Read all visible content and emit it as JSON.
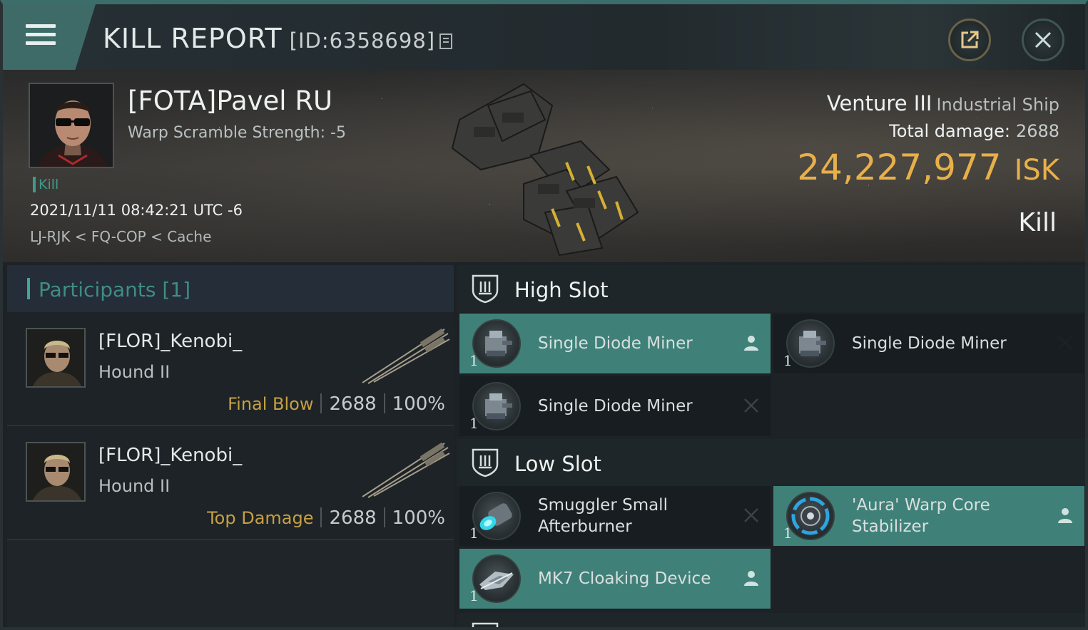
{
  "window": {
    "title": "KILL REPORT",
    "report_id": "[ID:6358698]",
    "icons": {
      "menu": "hamburger-icon",
      "copy": "copy-icon",
      "share": "share-external-icon",
      "close": "close-icon"
    }
  },
  "victim": {
    "name": "[FOTA]Pavel RU",
    "warp_scramble": "Warp Scramble Strength: -5",
    "tag": "Kill",
    "datetime": "2021/11/11 08:42:21 UTC -6",
    "location": "LJ-RJK < FQ-COP < Cache",
    "ship_name": "Venture III",
    "ship_class": "Industrial Ship",
    "total_damage_label": "Total damage:",
    "total_damage_value": "2688",
    "isk_value": "24,227,977",
    "isk_unit": "ISK",
    "outcome": "Kill"
  },
  "participants": {
    "header": "Participants [1]",
    "items": [
      {
        "name": "[FLOR]_Kenobi_",
        "ship": "Hound II",
        "role": "Final Blow",
        "damage": "2688",
        "percent": "100%"
      },
      {
        "name": "[FLOR]_Kenobi_",
        "ship": "Hound II",
        "role": "Top Damage",
        "damage": "2688",
        "percent": "100%"
      }
    ]
  },
  "slots": {
    "high": {
      "label": "High Slot",
      "modules": [
        {
          "name": "Single Diode Miner",
          "qty": "1",
          "status": "dropped",
          "icon": "miner-icon"
        },
        {
          "name": "Single Diode Miner",
          "qty": "1",
          "status": "destroyed",
          "icon": "miner-icon"
        },
        {
          "name": "Single Diode Miner",
          "qty": "1",
          "status": "destroyed",
          "icon": "miner-icon"
        }
      ]
    },
    "low": {
      "label": "Low Slot",
      "modules": [
        {
          "name": "Smuggler Small Afterburner",
          "qty": "1",
          "status": "destroyed",
          "icon": "afterburner-icon"
        },
        {
          "name": "'Aura' Warp Core Stabilizer",
          "qty": "1",
          "status": "dropped",
          "icon": "warp-core-stabilizer-icon"
        },
        {
          "name": "MK7 Cloaking Device",
          "qty": "1",
          "status": "dropped",
          "icon": "cloaking-device-icon"
        }
      ]
    }
  },
  "colors": {
    "accent_teal": "#3f8178",
    "isk_gold": "#e8b04a",
    "role_gold": "#c7a044"
  }
}
